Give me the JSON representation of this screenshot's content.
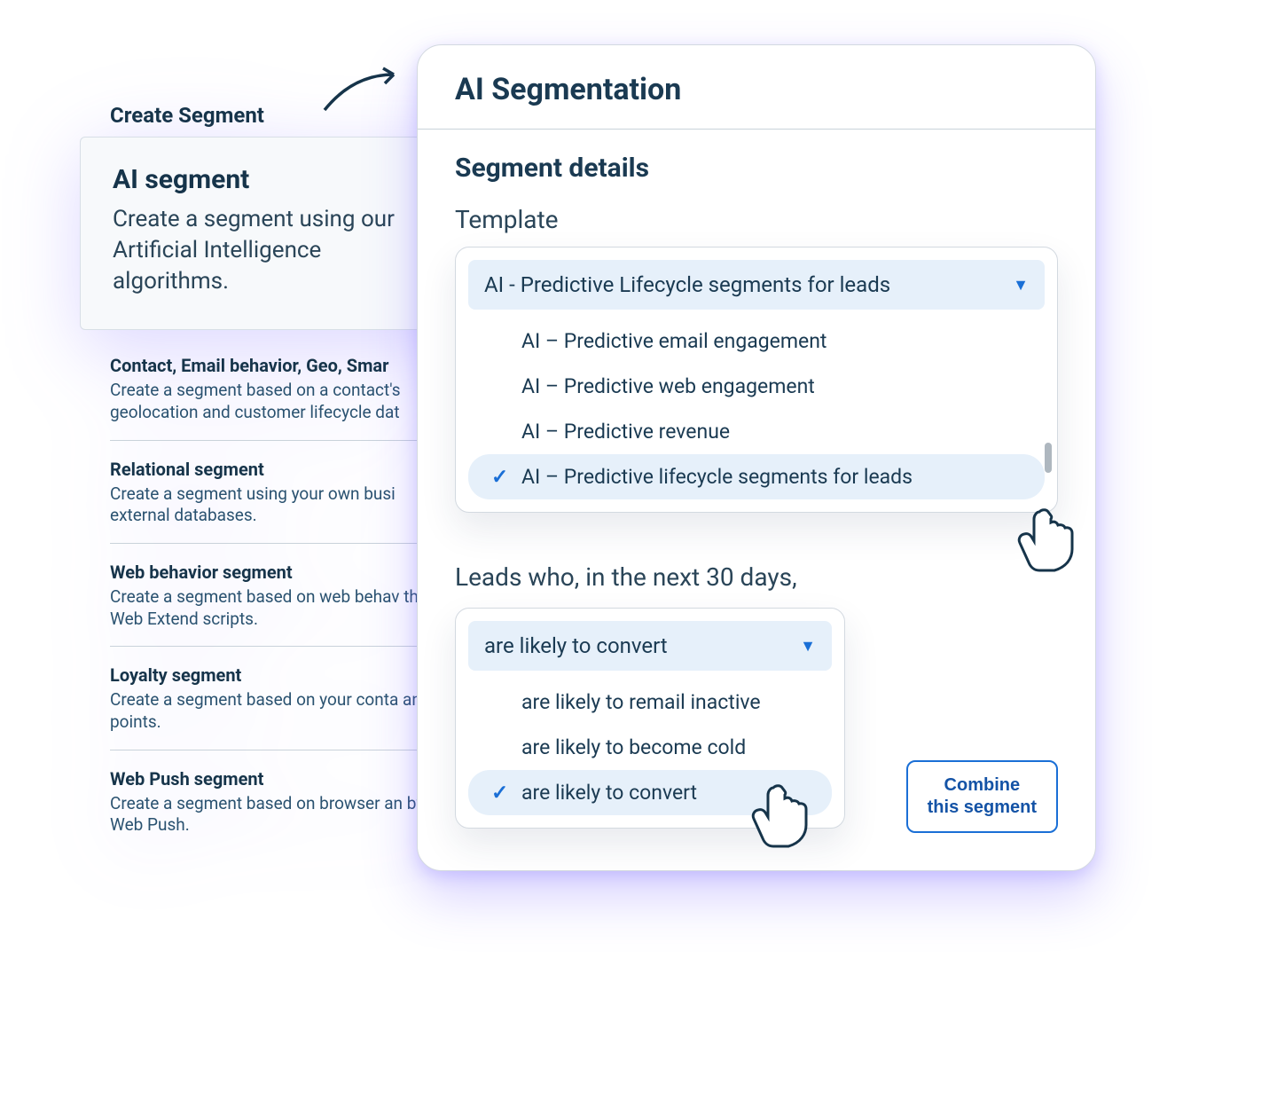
{
  "left": {
    "title": "Create Segment",
    "ai_card": {
      "title": "AI segment",
      "desc": "Create a segment using our Artificial Intelligence algorithms."
    },
    "items": [
      {
        "title": "Contact, Email behavior, Geo, Smar",
        "desc": "Create a segment based on a contact's geolocation and customer lifecycle dat"
      },
      {
        "title": "Relational segment",
        "desc": "Create a segment using your own busi external databases."
      },
      {
        "title": "Web behavior segment",
        "desc": "Create a segment based on web behav the Web Extend scripts."
      },
      {
        "title": "Loyalty segment",
        "desc": "Create a segment based on your conta and points."
      },
      {
        "title": "Web Push segment",
        "desc": "Create a segment based on browser an by Web Push."
      }
    ]
  },
  "right": {
    "title": "AI Segmentation",
    "section": "Segment details",
    "template_label": "Template",
    "template_select": {
      "selected": "AI - Predictive Lifecycle segments for leads",
      "options": [
        {
          "label": "AI – Predictive email engagement",
          "selected": false
        },
        {
          "label": "AI – Predictive web engagement",
          "selected": false
        },
        {
          "label": "AI – Predictive revenue",
          "selected": false
        },
        {
          "label": "AI – Predictive lifecycle segments for leads",
          "selected": true
        }
      ]
    },
    "criteria_label": "Leads who, in the next 30 days,",
    "criteria_select": {
      "selected": "are likely to convert",
      "options": [
        {
          "label": "are likely to remail inactive",
          "selected": false
        },
        {
          "label": "are likely to become cold",
          "selected": false
        },
        {
          "label": "are likely to convert",
          "selected": true
        }
      ]
    },
    "combine_button": "Combine\nthis segment"
  }
}
